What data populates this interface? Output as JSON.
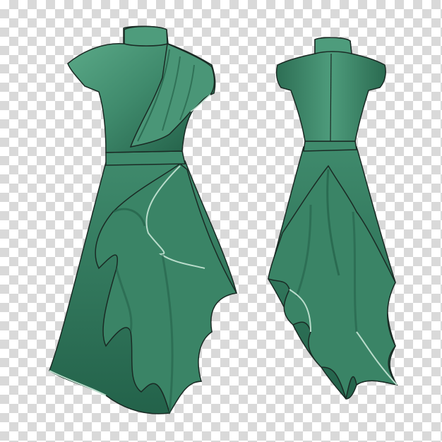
{
  "image": {
    "background": "transparency-checkerboard",
    "colors": {
      "checker_light": "#ffffff",
      "checker_dark": "#d9d9d9",
      "fabric_base": "#3f8a6c",
      "fabric_light": "#5fae8c",
      "fabric_dark": "#1f5a43",
      "outline": "#1a2a24",
      "hem_highlight": "#b9dccb"
    },
    "subjects": [
      {
        "name": "dress-front-view",
        "icon": "dress-icon"
      },
      {
        "name": "dress-back-view",
        "icon": "dress-icon"
      }
    ]
  }
}
